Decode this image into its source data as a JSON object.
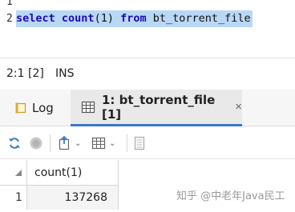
{
  "editor": {
    "line_numbers": [
      "1",
      "2"
    ],
    "code": {
      "kw_select": "select",
      "kw_count": "count",
      "paren": "(1)",
      "kw_from": "from",
      "table": "bt_torrent_file"
    }
  },
  "status": {
    "position": "2:1 [2]",
    "mode": "INS"
  },
  "tabs": [
    {
      "label": "Log",
      "icon": "log-icon"
    },
    {
      "label": "1: bt_torrent_file [1]",
      "icon": "table-icon",
      "close": "×"
    }
  ],
  "toolbar": {
    "items": [
      "refresh-icon",
      "stop-icon",
      "export-icon",
      "view-mode-icon",
      "settings-icon"
    ],
    "dropdown_glyph": "⌄"
  },
  "grid": {
    "columns": [
      "count(1)"
    ],
    "rows": [
      {
        "num": "1",
        "values": [
          "137268"
        ]
      }
    ]
  },
  "watermark": "知乎 @中老年Java民工",
  "colors": {
    "keyword": "#1c0ab8",
    "selection": "#b9d8f5",
    "active_tab_underline": "#3b78c4"
  }
}
